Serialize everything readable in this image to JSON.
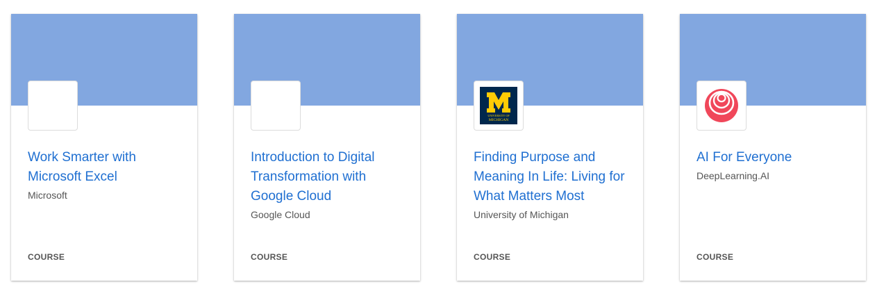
{
  "colors": {
    "banner": "#82a7e0",
    "title_link": "#1f6fd1",
    "michigan_blue": "#00274c",
    "michigan_maize": "#ffcb05",
    "deeplearning_red": "#f0475a"
  },
  "cards": [
    {
      "title": "Work Smarter with Microsoft Excel",
      "partner": "Microsoft",
      "type": "COURSE",
      "logo": "blank-logo"
    },
    {
      "title": "Introduction to Digital Transformation with Google Cloud",
      "partner": "Google Cloud",
      "type": "COURSE",
      "logo": "blank-logo"
    },
    {
      "title": "Finding Purpose and Meaning In Life: Living for What Matters Most",
      "partner": "University of Michigan",
      "type": "COURSE",
      "logo": "university-of-michigan-logo",
      "logo_text": {
        "letter": "M",
        "line1": "UNIVERSITY OF",
        "line2": "MICHIGAN"
      }
    },
    {
      "title": "AI For Everyone",
      "partner": "DeepLearning.AI",
      "type": "COURSE",
      "logo": "deeplearning-ai-logo"
    }
  ]
}
